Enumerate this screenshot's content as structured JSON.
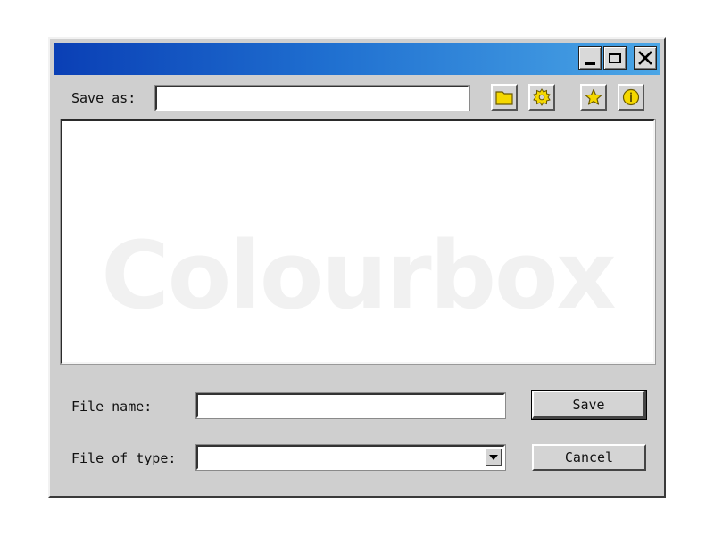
{
  "dialog": {
    "title": "",
    "title_gradient": [
      "#0a3fb5",
      "#4ba6e6"
    ],
    "window_bg": "#cfcfcf",
    "titlebar_buttons": [
      "minimize-icon",
      "maximize-icon",
      "close-icon"
    ]
  },
  "save_as": {
    "label": "Save as:",
    "value": "",
    "toolbar_icons": [
      "folder-icon",
      "gear-icon",
      "star-icon",
      "info-icon"
    ],
    "icon_color": "#f5d800"
  },
  "list": {
    "items": [],
    "watermark": "Colourbox"
  },
  "file_name": {
    "label": "File name:",
    "value": ""
  },
  "file_type": {
    "label": "File of type:",
    "value": ""
  },
  "buttons": {
    "save_label": "Save",
    "cancel_label": "Cancel"
  }
}
